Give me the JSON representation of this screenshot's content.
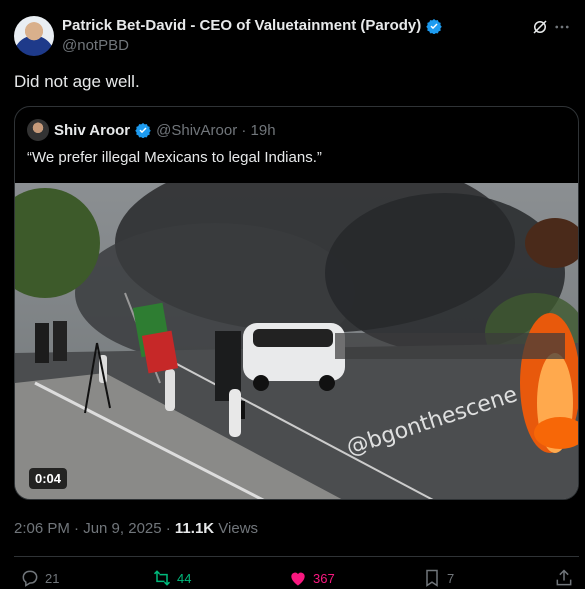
{
  "author": {
    "display_name": "Patrick Bet-David - CEO of Valuetainment (Parody)",
    "handle": "@notPBD"
  },
  "post": {
    "text": "Did not age well."
  },
  "quoted_post": {
    "display_name": "Shiv Aroor",
    "handle_time": "@ShivAroor · 19h",
    "text": "“We prefer illegal Mexicans to legal Indians.”",
    "video": {
      "duration": "0:04",
      "watermark": "@bgonthescene"
    }
  },
  "meta": {
    "time_date": "2:06 PM · Jun 9, 2025 · ",
    "views_count": "11.1K",
    "views_label": " Views"
  },
  "actions": {
    "replies": "21",
    "reposts": "44",
    "likes": "367",
    "bookmarks": "7"
  },
  "colors": {
    "verified": "#1d9bf0",
    "repost": "#00ba7c",
    "like": "#f91880",
    "muted": "#71767b"
  },
  "icons": [
    "verified-badge-icon",
    "grok-icon",
    "more-icon",
    "reply-icon",
    "repost-icon",
    "heart-icon",
    "bookmark-icon",
    "share-icon"
  ]
}
